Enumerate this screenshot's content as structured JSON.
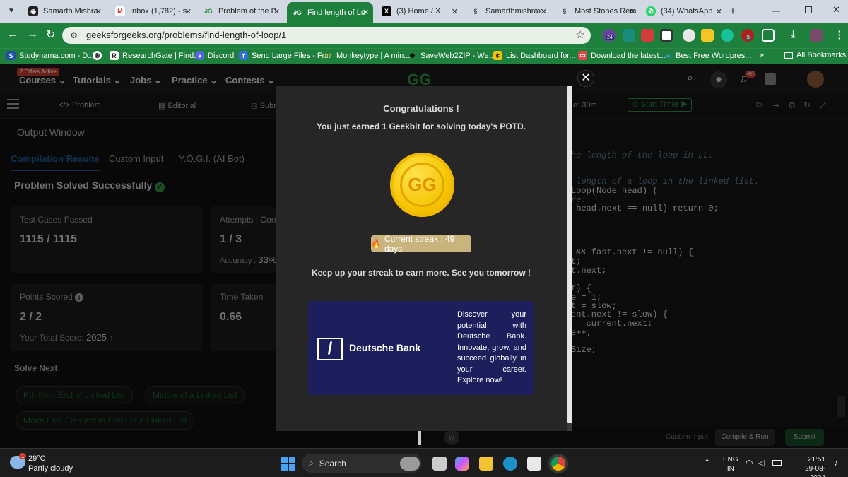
{
  "browser": {
    "tabs": [
      {
        "label": "Samarth Mishra",
        "icon": "github-icon",
        "color": "#222222"
      },
      {
        "label": "Inbox (1,782) - s",
        "icon": "gmail-icon",
        "color": "#d93025"
      },
      {
        "label": "Problem of the D",
        "icon": "gfg-icon",
        "color": "#2f8d46"
      },
      {
        "label": "Find length of Lo",
        "icon": "gfg-icon",
        "color": "#2f8d46"
      },
      {
        "label": "(3) Home / X",
        "icon": "x-icon",
        "color": "#000000"
      },
      {
        "label": "Samarthmishrax",
        "icon": "leetcode-icon",
        "color": "#444444"
      },
      {
        "label": "Most Stones Rem",
        "icon": "leetcode-icon",
        "color": "#444444"
      },
      {
        "label": "(34) WhatsApp",
        "icon": "whatsapp-icon",
        "color": "#25d366"
      }
    ],
    "url": "geeksforgeeks.org/problems/find-length-of-loop/1",
    "bookmarks": [
      {
        "label": "Studynama.com - D..."
      },
      {
        "label": ""
      },
      {
        "label": "ResearchGate | Find..."
      },
      {
        "label": "Discord"
      },
      {
        "label": "Send Large Files - Fr..."
      },
      {
        "label": "Monkeytype | A min..."
      },
      {
        "label": "SaveWeb2ZIP - We..."
      },
      {
        "label": "List Dashboard for..."
      },
      {
        "label": "Download the latest..."
      },
      {
        "label": "Best Free Wordpres..."
      }
    ],
    "bookmarks_more": "»",
    "all_bookmarks": "All Bookmarks",
    "ext_badges": {
      "purple": "24",
      "red": "5"
    }
  },
  "site": {
    "offer_badge": "2 Offers Active",
    "nav": [
      "Courses",
      "Tutorials",
      "Jobs",
      "Practice",
      "Contests"
    ],
    "logo": "GG",
    "notif_count": "60",
    "sub_tabs": [
      "Problem",
      "Editorial",
      "Subr"
    ],
    "time_label": "e: 30m",
    "start_timer": "Start Timer"
  },
  "left_panel": {
    "output_window": "Output Window",
    "tabs": [
      "Compilation Results",
      "Custom Input",
      "Y.O.G.I. (AI Bot)"
    ],
    "status": "Problem Solved Successfully",
    "test_cases_label": "Test Cases Passed",
    "test_cases_value": "1115 / 1115",
    "attempts_label": "Attempts : Corr",
    "attempts_value": "1 / 3",
    "accuracy_label": "Accuracy :",
    "accuracy_value": "33%",
    "points_label": "Points Scored",
    "points_value": "2 / 2",
    "total_score_label": "Your Total Score:",
    "total_score_value": "2025",
    "time_label": "Time Taken",
    "time_value": "0.66",
    "solve_next_label": "Solve Next",
    "solve_next": [
      "Kth from End of Linked List",
      "Middle of a Linked List",
      "Move Last Element to Front of a Linked List"
    ]
  },
  "code_lines": [
    {
      "text": "he length of the loop in LL.",
      "comment": true
    },
    {
      "text": " length of a loop in the linked list.",
      "comment": true
    },
    {
      "text": "Loop(Node head) {",
      "comment": false
    },
    {
      "text": "re:",
      "comment": true
    },
    {
      "text": " head.next == null) return 0;",
      "comment": false
    },
    {
      "text": " && fast.next != null) {",
      "comment": false
    },
    {
      "text": "t;",
      "comment": false
    },
    {
      "text": "t.next;",
      "comment": false
    },
    {
      "text": "t) {",
      "comment": false
    },
    {
      "text": "e = 1;",
      "comment": false
    },
    {
      "text": "t = slow;",
      "comment": false
    },
    {
      "text": "ent.next != slow) {",
      "comment": false
    },
    {
      "text": " = current.next;",
      "comment": false
    },
    {
      "text": "e++;",
      "comment": false
    },
    {
      "text": "Size;",
      "comment": false
    }
  ],
  "bottom_bar": {
    "custom_input": "Custom Input",
    "compile_run": "Compile & Run",
    "submit": "Submit"
  },
  "modal": {
    "title": "Congratulations !",
    "subtitle": "You just earned 1 Geekbit for solving today's POTD.",
    "streak": "Current streak : 49 days",
    "keep_up": "Keep up your streak to earn more. See you tomorrow !",
    "ad_brand": "Deutsche Bank",
    "ad_text": "Discover your potential with Deutsche Bank. Innovate, grow, and succeed globally in your career. Explore now!"
  },
  "taskbar": {
    "weather_temp": "29°C",
    "weather_desc": "Partly cloudy",
    "weather_badge": "1",
    "search": "Search",
    "lang": "ENG",
    "region": "IN",
    "time": "21:51",
    "date": "29-08-2024"
  },
  "colors": {
    "accent": "#2f8d46",
    "chrome_green": "#1f7f3c",
    "modal_bg": "#262626",
    "streak": "#c9b47d",
    "ad_bg": "#1c1f5c",
    "coin": "#f5c400"
  }
}
